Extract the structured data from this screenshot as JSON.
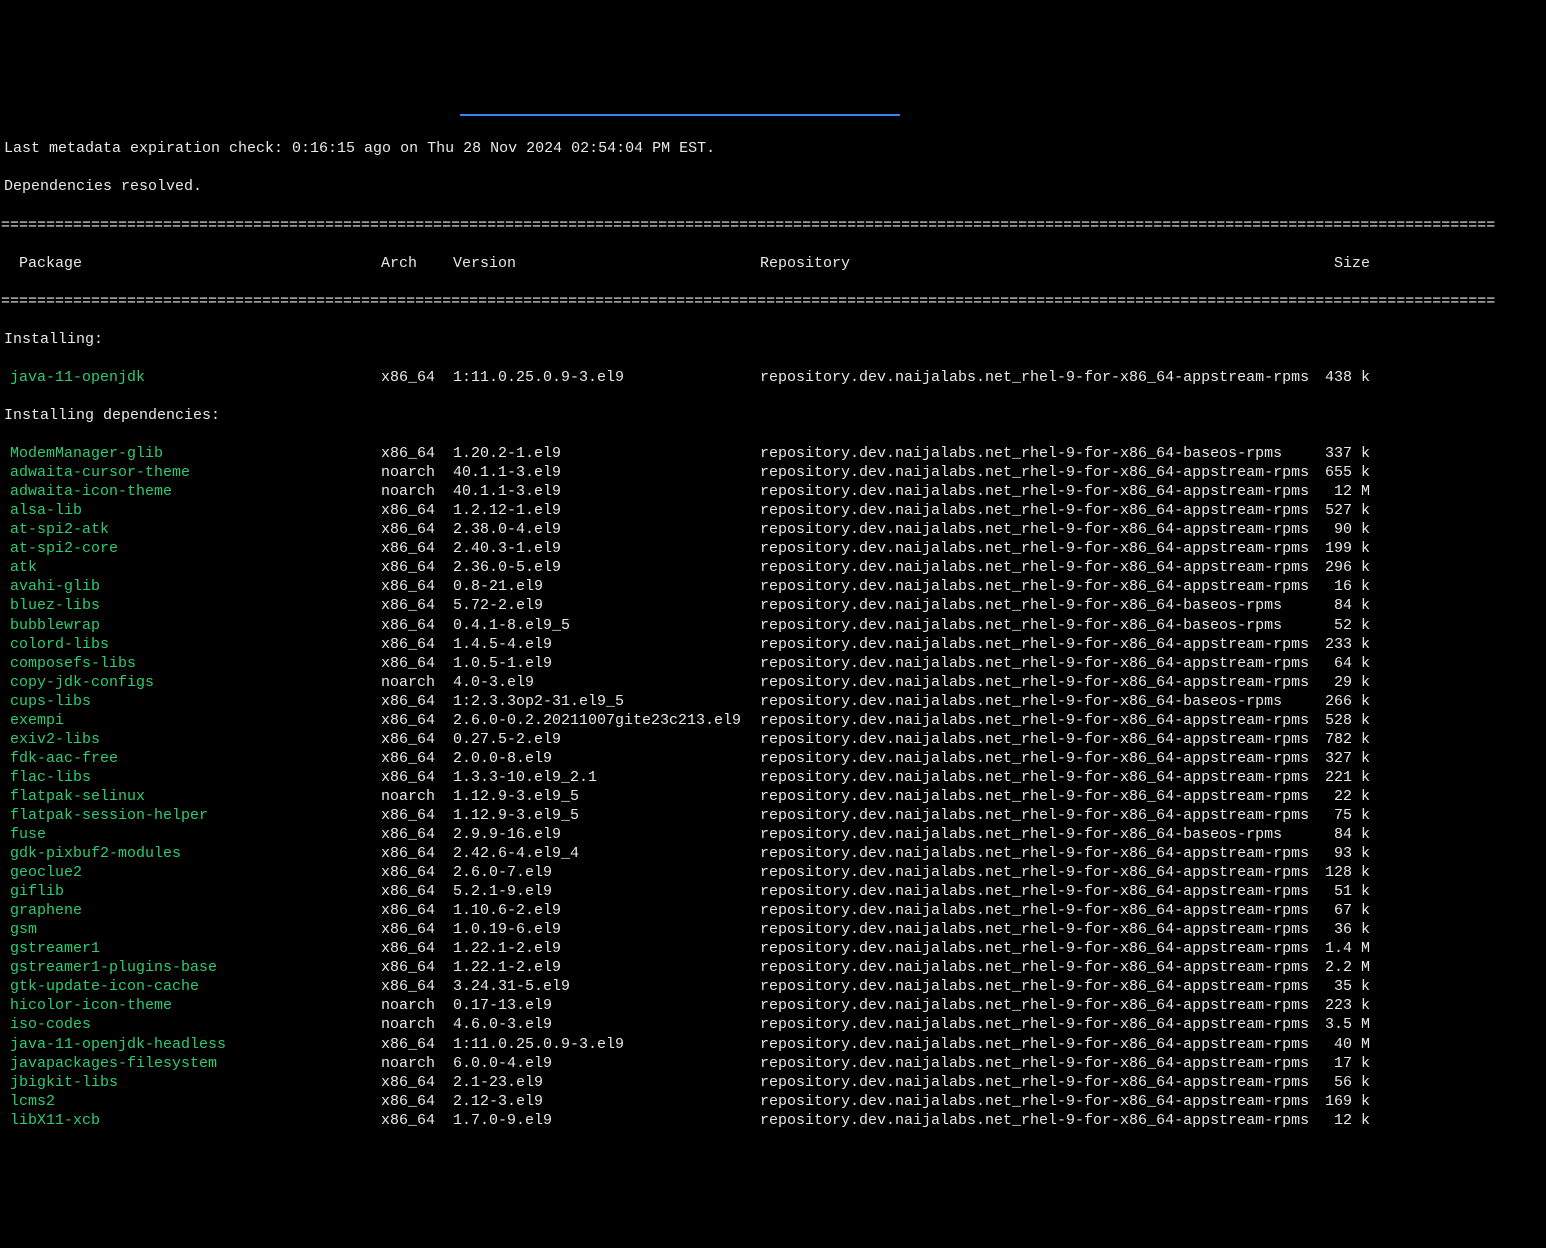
{
  "metadata_line": "Last metadata expiration check: 0:16:15 ago on Thu 28 Nov 2024 02:54:04 PM EST.",
  "deps_line": "Dependencies resolved.",
  "divider": "======================================================================================================================================================================",
  "headers": {
    "package": " Package",
    "arch": "Arch",
    "version": "Version",
    "repository": "Repository",
    "size": "Size"
  },
  "installing_label": "Installing:",
  "installing_deps_label": "Installing dependencies:",
  "installing": [
    {
      "pkg": "java-11-openjdk",
      "arch": "x86_64",
      "ver": "1:11.0.25.0.9-3.el9",
      "repo": "repository.dev.naijalabs.net_rhel-9-for-x86_64-appstream-rpms",
      "size": "438 k"
    }
  ],
  "dependencies": [
    {
      "pkg": "ModemManager-glib",
      "arch": "x86_64",
      "ver": "1.20.2-1.el9",
      "repo": "repository.dev.naijalabs.net_rhel-9-for-x86_64-baseos-rpms",
      "size": "337 k"
    },
    {
      "pkg": "adwaita-cursor-theme",
      "arch": "noarch",
      "ver": "40.1.1-3.el9",
      "repo": "repository.dev.naijalabs.net_rhel-9-for-x86_64-appstream-rpms",
      "size": "655 k"
    },
    {
      "pkg": "adwaita-icon-theme",
      "arch": "noarch",
      "ver": "40.1.1-3.el9",
      "repo": "repository.dev.naijalabs.net_rhel-9-for-x86_64-appstream-rpms",
      "size": "12 M"
    },
    {
      "pkg": "alsa-lib",
      "arch": "x86_64",
      "ver": "1.2.12-1.el9",
      "repo": "repository.dev.naijalabs.net_rhel-9-for-x86_64-appstream-rpms",
      "size": "527 k"
    },
    {
      "pkg": "at-spi2-atk",
      "arch": "x86_64",
      "ver": "2.38.0-4.el9",
      "repo": "repository.dev.naijalabs.net_rhel-9-for-x86_64-appstream-rpms",
      "size": "90 k"
    },
    {
      "pkg": "at-spi2-core",
      "arch": "x86_64",
      "ver": "2.40.3-1.el9",
      "repo": "repository.dev.naijalabs.net_rhel-9-for-x86_64-appstream-rpms",
      "size": "199 k"
    },
    {
      "pkg": "atk",
      "arch": "x86_64",
      "ver": "2.36.0-5.el9",
      "repo": "repository.dev.naijalabs.net_rhel-9-for-x86_64-appstream-rpms",
      "size": "296 k"
    },
    {
      "pkg": "avahi-glib",
      "arch": "x86_64",
      "ver": "0.8-21.el9",
      "repo": "repository.dev.naijalabs.net_rhel-9-for-x86_64-appstream-rpms",
      "size": "16 k"
    },
    {
      "pkg": "bluez-libs",
      "arch": "x86_64",
      "ver": "5.72-2.el9",
      "repo": "repository.dev.naijalabs.net_rhel-9-for-x86_64-baseos-rpms",
      "size": "84 k"
    },
    {
      "pkg": "bubblewrap",
      "arch": "x86_64",
      "ver": "0.4.1-8.el9_5",
      "repo": "repository.dev.naijalabs.net_rhel-9-for-x86_64-baseos-rpms",
      "size": "52 k"
    },
    {
      "pkg": "colord-libs",
      "arch": "x86_64",
      "ver": "1.4.5-4.el9",
      "repo": "repository.dev.naijalabs.net_rhel-9-for-x86_64-appstream-rpms",
      "size": "233 k"
    },
    {
      "pkg": "composefs-libs",
      "arch": "x86_64",
      "ver": "1.0.5-1.el9",
      "repo": "repository.dev.naijalabs.net_rhel-9-for-x86_64-appstream-rpms",
      "size": "64 k"
    },
    {
      "pkg": "copy-jdk-configs",
      "arch": "noarch",
      "ver": "4.0-3.el9",
      "repo": "repository.dev.naijalabs.net_rhel-9-for-x86_64-appstream-rpms",
      "size": "29 k"
    },
    {
      "pkg": "cups-libs",
      "arch": "x86_64",
      "ver": "1:2.3.3op2-31.el9_5",
      "repo": "repository.dev.naijalabs.net_rhel-9-for-x86_64-baseos-rpms",
      "size": "266 k"
    },
    {
      "pkg": "exempi",
      "arch": "x86_64",
      "ver": "2.6.0-0.2.20211007gite23c213.el9",
      "repo": "repository.dev.naijalabs.net_rhel-9-for-x86_64-appstream-rpms",
      "size": "528 k"
    },
    {
      "pkg": "exiv2-libs",
      "arch": "x86_64",
      "ver": "0.27.5-2.el9",
      "repo": "repository.dev.naijalabs.net_rhel-9-for-x86_64-appstream-rpms",
      "size": "782 k"
    },
    {
      "pkg": "fdk-aac-free",
      "arch": "x86_64",
      "ver": "2.0.0-8.el9",
      "repo": "repository.dev.naijalabs.net_rhel-9-for-x86_64-appstream-rpms",
      "size": "327 k"
    },
    {
      "pkg": "flac-libs",
      "arch": "x86_64",
      "ver": "1.3.3-10.el9_2.1",
      "repo": "repository.dev.naijalabs.net_rhel-9-for-x86_64-appstream-rpms",
      "size": "221 k"
    },
    {
      "pkg": "flatpak-selinux",
      "arch": "noarch",
      "ver": "1.12.9-3.el9_5",
      "repo": "repository.dev.naijalabs.net_rhel-9-for-x86_64-appstream-rpms",
      "size": "22 k"
    },
    {
      "pkg": "flatpak-session-helper",
      "arch": "x86_64",
      "ver": "1.12.9-3.el9_5",
      "repo": "repository.dev.naijalabs.net_rhel-9-for-x86_64-appstream-rpms",
      "size": "75 k"
    },
    {
      "pkg": "fuse",
      "arch": "x86_64",
      "ver": "2.9.9-16.el9",
      "repo": "repository.dev.naijalabs.net_rhel-9-for-x86_64-baseos-rpms",
      "size": "84 k"
    },
    {
      "pkg": "gdk-pixbuf2-modules",
      "arch": "x86_64",
      "ver": "2.42.6-4.el9_4",
      "repo": "repository.dev.naijalabs.net_rhel-9-for-x86_64-appstream-rpms",
      "size": "93 k"
    },
    {
      "pkg": "geoclue2",
      "arch": "x86_64",
      "ver": "2.6.0-7.el9",
      "repo": "repository.dev.naijalabs.net_rhel-9-for-x86_64-appstream-rpms",
      "size": "128 k"
    },
    {
      "pkg": "giflib",
      "arch": "x86_64",
      "ver": "5.2.1-9.el9",
      "repo": "repository.dev.naijalabs.net_rhel-9-for-x86_64-appstream-rpms",
      "size": "51 k"
    },
    {
      "pkg": "graphene",
      "arch": "x86_64",
      "ver": "1.10.6-2.el9",
      "repo": "repository.dev.naijalabs.net_rhel-9-for-x86_64-appstream-rpms",
      "size": "67 k"
    },
    {
      "pkg": "gsm",
      "arch": "x86_64",
      "ver": "1.0.19-6.el9",
      "repo": "repository.dev.naijalabs.net_rhel-9-for-x86_64-appstream-rpms",
      "size": "36 k"
    },
    {
      "pkg": "gstreamer1",
      "arch": "x86_64",
      "ver": "1.22.1-2.el9",
      "repo": "repository.dev.naijalabs.net_rhel-9-for-x86_64-appstream-rpms",
      "size": "1.4 M"
    },
    {
      "pkg": "gstreamer1-plugins-base",
      "arch": "x86_64",
      "ver": "1.22.1-2.el9",
      "repo": "repository.dev.naijalabs.net_rhel-9-for-x86_64-appstream-rpms",
      "size": "2.2 M"
    },
    {
      "pkg": "gtk-update-icon-cache",
      "arch": "x86_64",
      "ver": "3.24.31-5.el9",
      "repo": "repository.dev.naijalabs.net_rhel-9-for-x86_64-appstream-rpms",
      "size": "35 k"
    },
    {
      "pkg": "hicolor-icon-theme",
      "arch": "noarch",
      "ver": "0.17-13.el9",
      "repo": "repository.dev.naijalabs.net_rhel-9-for-x86_64-appstream-rpms",
      "size": "223 k"
    },
    {
      "pkg": "iso-codes",
      "arch": "noarch",
      "ver": "4.6.0-3.el9",
      "repo": "repository.dev.naijalabs.net_rhel-9-for-x86_64-appstream-rpms",
      "size": "3.5 M"
    },
    {
      "pkg": "java-11-openjdk-headless",
      "arch": "x86_64",
      "ver": "1:11.0.25.0.9-3.el9",
      "repo": "repository.dev.naijalabs.net_rhel-9-for-x86_64-appstream-rpms",
      "size": "40 M"
    },
    {
      "pkg": "javapackages-filesystem",
      "arch": "noarch",
      "ver": "6.0.0-4.el9",
      "repo": "repository.dev.naijalabs.net_rhel-9-for-x86_64-appstream-rpms",
      "size": "17 k"
    },
    {
      "pkg": "jbigkit-libs",
      "arch": "x86_64",
      "ver": "2.1-23.el9",
      "repo": "repository.dev.naijalabs.net_rhel-9-for-x86_64-appstream-rpms",
      "size": "56 k"
    },
    {
      "pkg": "lcms2",
      "arch": "x86_64",
      "ver": "2.12-3.el9",
      "repo": "repository.dev.naijalabs.net_rhel-9-for-x86_64-appstream-rpms",
      "size": "169 k"
    },
    {
      "pkg": "libX11-xcb",
      "arch": "x86_64",
      "ver": "1.7.0-9.el9",
      "repo": "repository.dev.naijalabs.net_rhel-9-for-x86_64-appstream-rpms",
      "size": "12 k"
    }
  ]
}
